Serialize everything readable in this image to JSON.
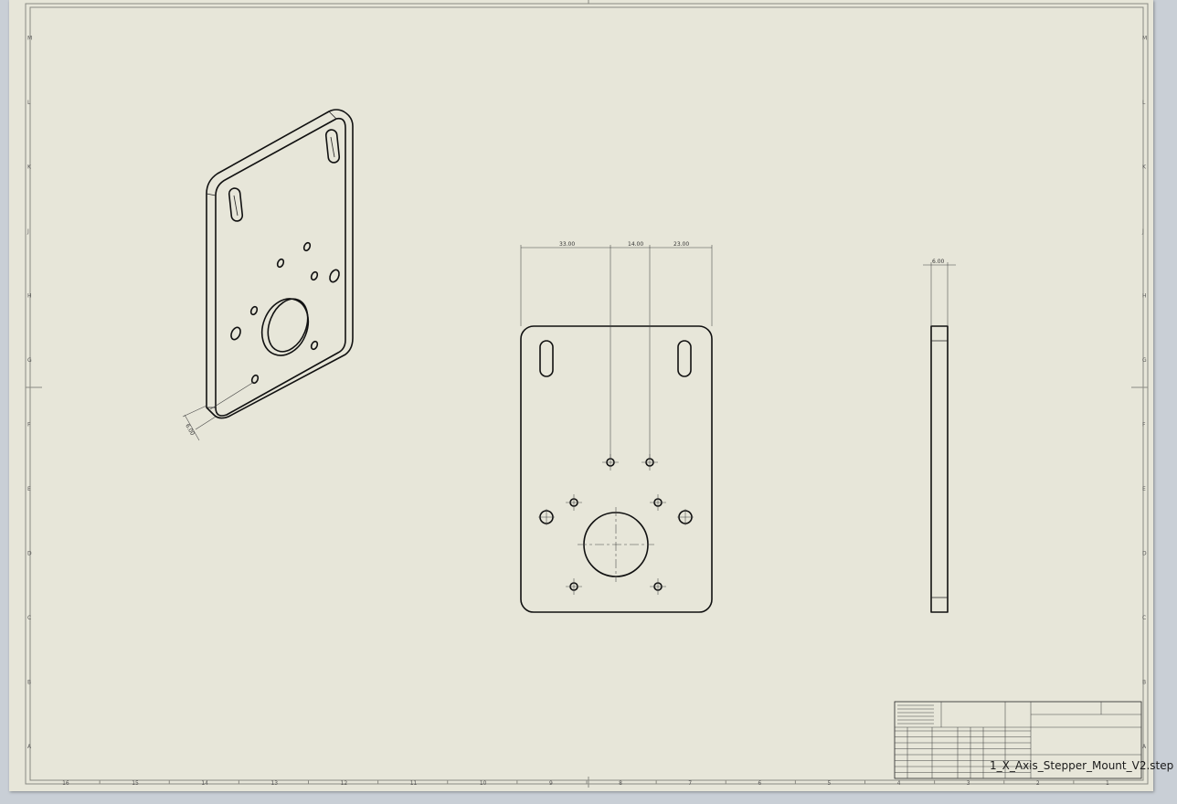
{
  "drawing": {
    "file_name": "1_X_Axis_Stepper_Mount_V2.step",
    "dimensions": {
      "front_left": "33.00",
      "front_mid": "14.00",
      "front_right": "23.00",
      "side_thickness": "6.00",
      "iso_thickness": "6.00"
    },
    "zones_bottom": [
      "16",
      "15",
      "14",
      "13",
      "12",
      "11",
      "10",
      "9",
      "8",
      "7",
      "6",
      "5",
      "4",
      "3",
      "2",
      "1"
    ],
    "zones_side": [
      "M",
      "L",
      "K",
      "J",
      "H",
      "G",
      "F",
      "E",
      "D",
      "C",
      "B",
      "A"
    ]
  },
  "colors": {
    "sheet": "#e7e6d9",
    "background": "#c9cfd6",
    "line": "#111111"
  }
}
